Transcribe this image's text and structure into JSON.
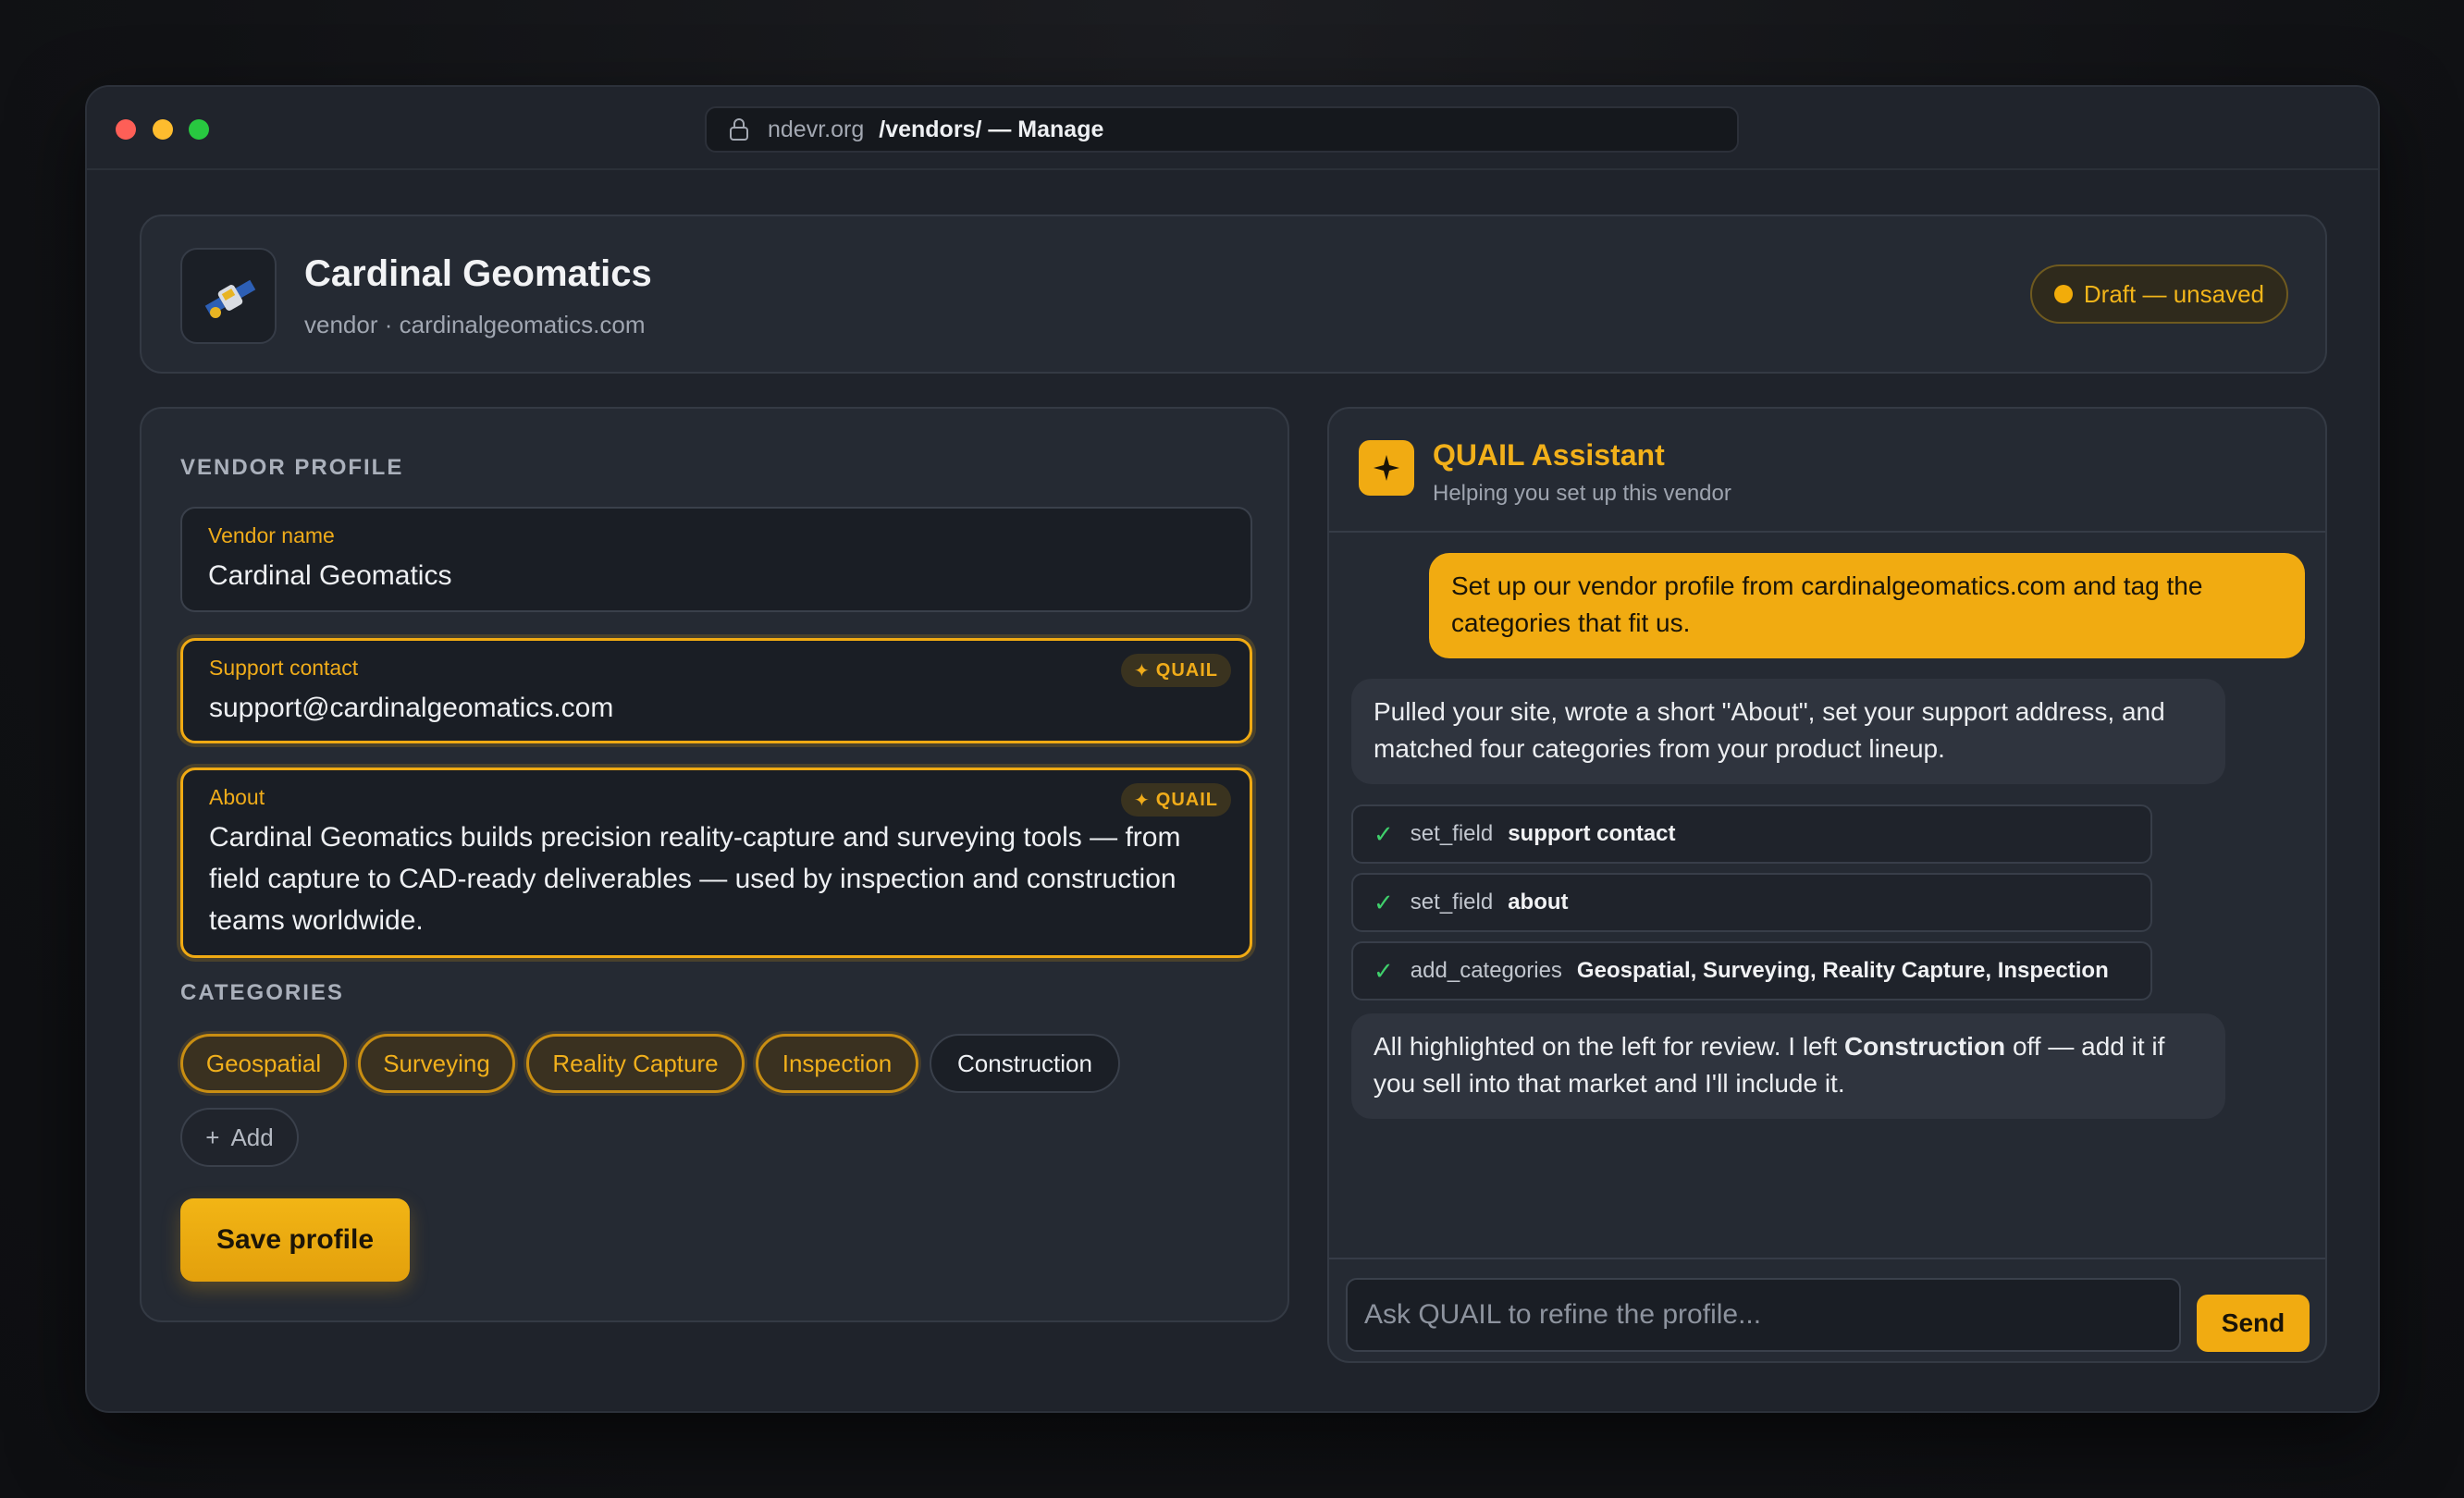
{
  "browser": {
    "host": "ndevr.org",
    "path": "/vendors/ — Manage"
  },
  "header": {
    "title": "Cardinal Geomatics",
    "subtitle": "vendor · cardinalgeomatics.com",
    "status_badge": "Draft — unsaved"
  },
  "profile": {
    "section_label": "VENDOR PROFILE",
    "fields": {
      "vendor_name": {
        "label": "Vendor name",
        "value": "Cardinal Geomatics"
      },
      "support_contact": {
        "label": "Support contact",
        "value": "support@cardinalgeomatics.com",
        "tag": "QUAIL"
      },
      "about": {
        "label": "About",
        "value": "Cardinal Geomatics builds precision reality-capture and surveying tools — from field capture to CAD-ready deliverables — used by inspection and construction teams worldwide.",
        "tag": "QUAIL"
      }
    },
    "categories_label": "CATEGORIES",
    "categories": [
      {
        "label": "Geospatial",
        "selected": true
      },
      {
        "label": "Surveying",
        "selected": true
      },
      {
        "label": "Reality Capture",
        "selected": true
      },
      {
        "label": "Inspection",
        "selected": true
      },
      {
        "label": "Construction",
        "selected": false
      }
    ],
    "add_label": "Add",
    "save_label": "Save profile"
  },
  "assistant": {
    "title": "QUAIL Assistant",
    "subtitle": "Helping you set up this vendor",
    "user_message": "Set up our vendor profile from cardinalgeomatics.com and tag the categories that fit us.",
    "bot_message_1": "Pulled your site, wrote a short \"About\", set your support address, and matched four categories from your product lineup.",
    "tools": [
      {
        "name": "set_field",
        "arg": "support contact"
      },
      {
        "name": "set_field",
        "arg": "about"
      },
      {
        "name": "add_categories",
        "arg": "Geospatial, Surveying, Reality Capture, Inspection"
      }
    ],
    "bot_message_2": {
      "before": "All highlighted on the left for review. I left ",
      "bold": "Construction",
      "after": " off — add it if you sell into that market and I'll include it."
    },
    "composer_placeholder": "Ask QUAIL to refine the profile...",
    "send_label": "Send"
  },
  "colors": {
    "accent": "#f1ab11",
    "background": "#1f232b",
    "card": "#252a33",
    "success": "#3fcf6b"
  }
}
